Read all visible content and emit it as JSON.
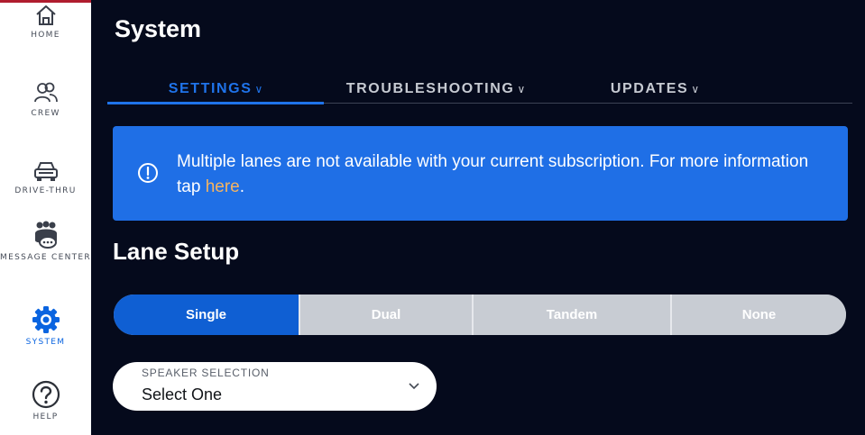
{
  "sidebar": {
    "items": [
      {
        "label": "HOME",
        "icon": "home-icon"
      },
      {
        "label": "CREW",
        "icon": "crew-icon"
      },
      {
        "label": "DRIVE-THRU",
        "icon": "car-icon"
      },
      {
        "label": "MESSAGE CENTER",
        "icon": "message-center-icon"
      },
      {
        "label": "SYSTEM",
        "icon": "gear-icon",
        "active": true
      },
      {
        "label": "HELP",
        "icon": "help-icon"
      }
    ],
    "accent_color": "#b01c2e",
    "active_color": "#0a64e0"
  },
  "header": {
    "title": "System"
  },
  "tabs": [
    {
      "label": "SETTINGS",
      "active": true
    },
    {
      "label": "TROUBLESHOOTING"
    },
    {
      "label": "UPDATES"
    }
  ],
  "alert": {
    "icon": "info-circle-icon",
    "text": "Multiple lanes are not available with your current subscription. For more information tap ",
    "link_text": "here",
    "text_end": ".",
    "background": "#1f6fe6",
    "link_color": "#f5b461"
  },
  "lane_setup": {
    "title": "Lane Setup",
    "options": [
      "Single",
      "Dual",
      "Tandem",
      "None"
    ],
    "selected": "Single"
  },
  "speaker_selection": {
    "label": "SPEAKER SELECTION",
    "value": "Select One"
  },
  "colors": {
    "background": "#050a1c",
    "accent": "#1f73ea"
  }
}
